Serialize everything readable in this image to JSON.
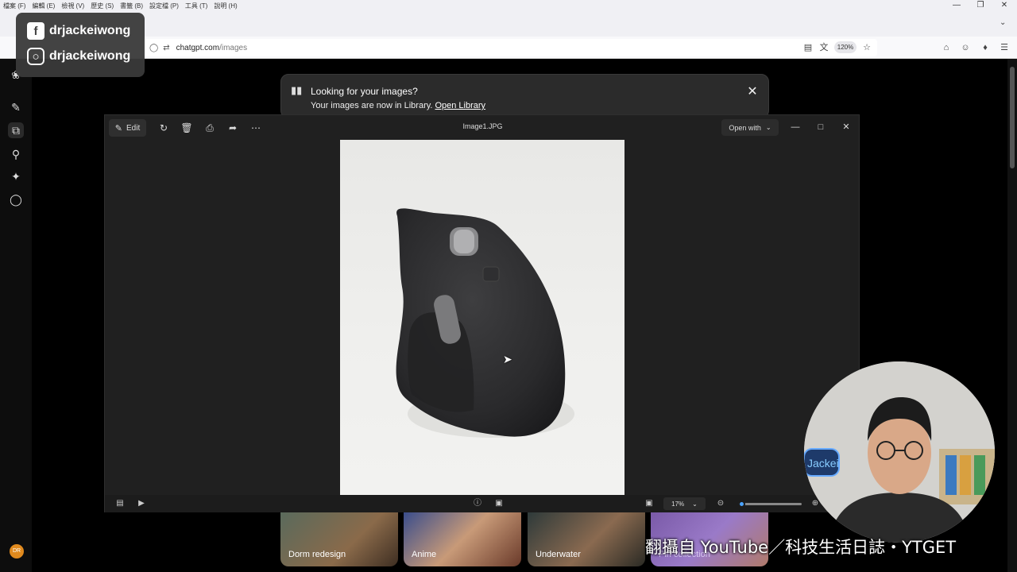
{
  "browser": {
    "menu": [
      "檔案 (F)",
      "編輯 (E)",
      "檢視 (V)",
      "歷史 (S)",
      "書籤 (B)",
      "設定檔 (P)",
      "工具 (T)",
      "說明 (H)"
    ],
    "url_host": "chatgpt.com",
    "url_path": "/images",
    "zoom": "120%"
  },
  "social": {
    "facebook": "drjackeiwong",
    "instagram": "drjackeiwong"
  },
  "notice": {
    "title": "Looking for your images?",
    "body": "Your images are now in Library.",
    "link": "Open Library"
  },
  "viewer": {
    "edit_label": "Edit",
    "filename": "Image1.JPG",
    "open_with": "Open with",
    "zoom": "17%",
    "zoom_fraction": 0.17
  },
  "library": {
    "tiles": [
      "Dorm redesign",
      "Anime",
      "Underwater",
      "Pin collection"
    ]
  },
  "overlay": {
    "watermark": "翻攝自 YouTube／科技生活日誌・YTGET",
    "sign_text": "Jackei"
  },
  "user": {
    "initials": "DR"
  },
  "colors": {
    "accent": "#4aa3ff",
    "avatar": "#e08a1e"
  }
}
